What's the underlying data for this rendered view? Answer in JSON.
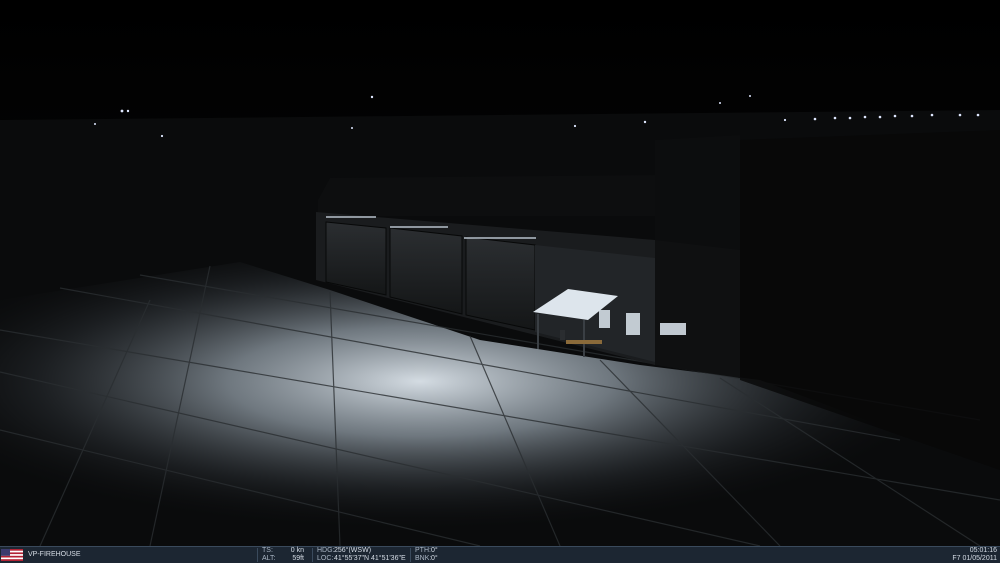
{
  "status": {
    "unit_name": "VP-FIREHOUSE",
    "ts_label": "TS:",
    "ts_value": "0 kn",
    "alt_label": "ALT:",
    "alt_value": "59ft",
    "hdg_label": "HDG:",
    "hdg_value": "256°(WSW)",
    "loc_label": "LOC:",
    "loc_value": "41°55'37\"N 41°51'36\"E",
    "pth_label": "PTH:",
    "pth_value": "0°",
    "bnk_label": "BNK:",
    "bnk_value": "0°",
    "time": "05:01:16",
    "date_line": "F7 01/05/2011"
  },
  "colors": {
    "status_bg": "#1c2632",
    "status_text": "#d6dde6",
    "flood_light": "#e6eef5"
  },
  "icons": {
    "flag": "us-flag-icon"
  }
}
